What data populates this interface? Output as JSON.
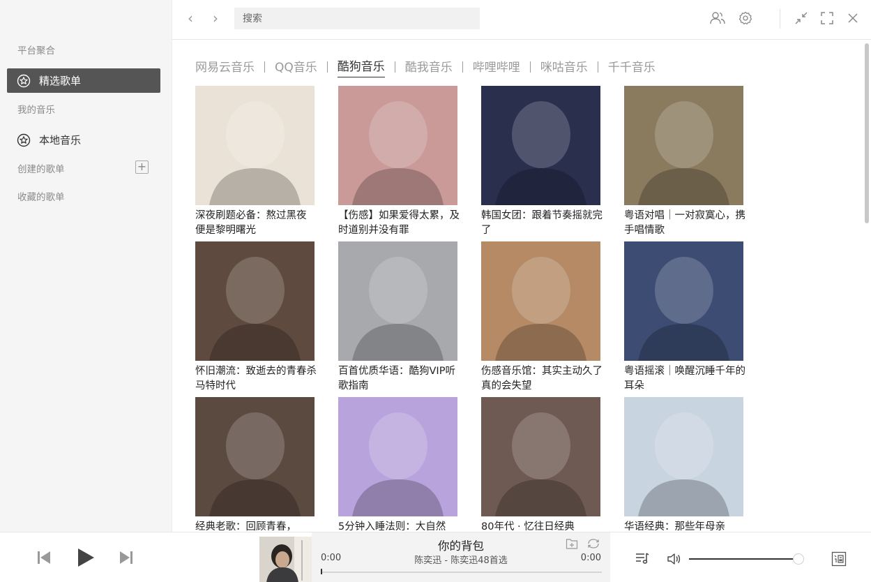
{
  "sidebar": {
    "platform_group": "平台聚合",
    "featured": "精选歌单",
    "my_music": "我的音乐",
    "local_music": "本地音乐",
    "created_playlists": "创建的歌单",
    "collected_playlists": "收藏的歌单",
    "add_symbol": "+"
  },
  "topbar": {
    "search_placeholder": "搜索",
    "back_symbol": "‹",
    "forward_symbol": "›"
  },
  "tabs": [
    {
      "label": "网易云音乐",
      "active": false
    },
    {
      "label": "QQ音乐",
      "active": false
    },
    {
      "label": "酷狗音乐",
      "active": true
    },
    {
      "label": "酷我音乐",
      "active": false
    },
    {
      "label": "哔哩哔哩",
      "active": false
    },
    {
      "label": "咪咕音乐",
      "active": false
    },
    {
      "label": "千千音乐",
      "active": false
    }
  ],
  "playlists": [
    {
      "title": "深夜刷题必备：熬过黑夜 便是黎明曙光",
      "color": "#eae2d6"
    },
    {
      "title": "【伤感】如果爱得太累，及时道别并没有罪",
      "color": "#c99a98"
    },
    {
      "title": "韩国女团：跟着节奏摇就完了",
      "color": "#2a2f4e"
    },
    {
      "title": "粤语对唱｜一对寂寞心，携手唱情歌",
      "color": "#8a7a5e"
    },
    {
      "title": "怀旧潮流：致逝去的青春杀马特时代",
      "color": "#5e4a3e"
    },
    {
      "title": "百首优质华语：酷狗VIP听歌指南",
      "color": "#a7a9ad"
    },
    {
      "title": "伤感音乐馆：其实主动久了真的会失望",
      "color": "#b58a64"
    },
    {
      "title": "粤语摇滚｜唤醒沉睡千年的耳朵",
      "color": "#3c4c72"
    },
    {
      "title": "经典老歌：回顾青春，",
      "color": "#5b4a40"
    },
    {
      "title": "5分钟入睡法则：大自然",
      "color": "#b9a3dc"
    },
    {
      "title": "80年代 · 忆往日经典",
      "color": "#6e5a52"
    },
    {
      "title": "华语经典：那些年母亲",
      "color": "#c8d4e0"
    }
  ],
  "player": {
    "song_title": "你的背包",
    "artist_album": "陈奕迅 - 陈奕迅48首选",
    "time_current": "0:00",
    "time_total": "0:00",
    "progress_fraction": 0,
    "volume_fraction": 0.95
  }
}
